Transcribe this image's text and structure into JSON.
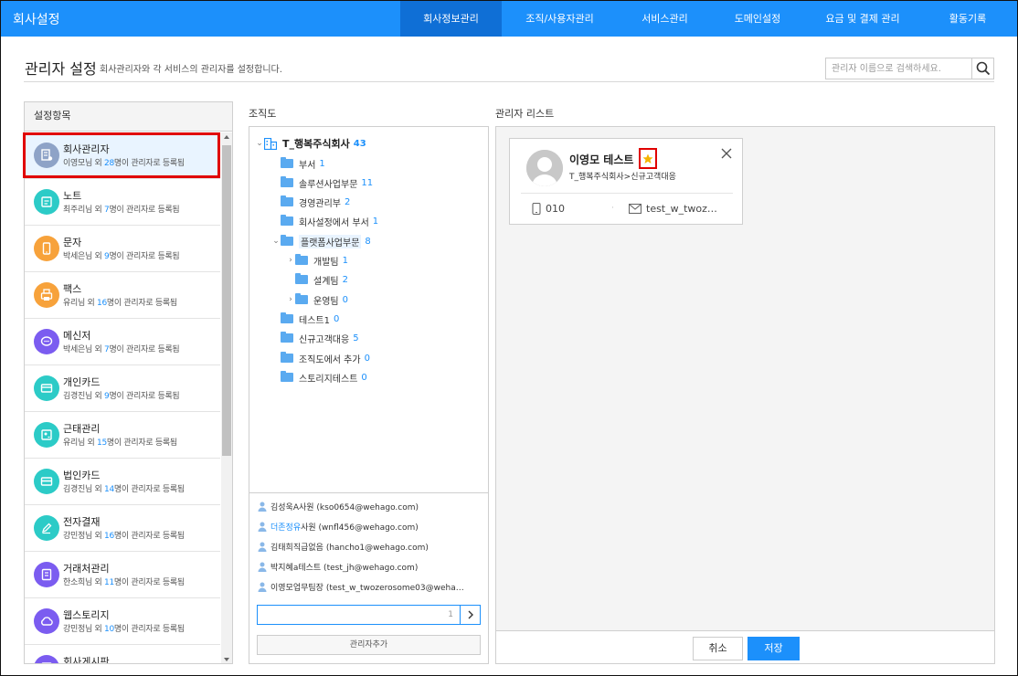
{
  "app_title": "회사설정",
  "top_nav": [
    {
      "label": "회사정보관리",
      "active": true
    },
    {
      "label": "조직/사용자관리",
      "active": false
    },
    {
      "label": "서비스관리",
      "active": false
    },
    {
      "label": "도메인설정",
      "active": false
    },
    {
      "label": "요금 및 결제 관리",
      "active": false
    },
    {
      "label": "활동기록",
      "active": false
    }
  ],
  "header": {
    "title": "관리자 설정",
    "description": "회사관리자와 각 서비스의 관리자를 설정합니다.",
    "search_placeholder": "관리자 이름으로 검색하세요."
  },
  "settings_panel": {
    "title": "설정항목",
    "items": [
      {
        "name": "회사관리자",
        "person": "이영모님 외 ",
        "count": "28",
        "suffix": "명이 관리자로 등록됨",
        "icon": "company-admin-icon",
        "color": "#8ea3c7",
        "selected": true
      },
      {
        "name": "노트",
        "person": "최주리님 외 ",
        "count": "7",
        "suffix": "명이 관리자로 등록됨",
        "icon": "note-icon",
        "color": "#2ccbc7",
        "selected": false
      },
      {
        "name": "문자",
        "person": "박세은님 외 ",
        "count": "9",
        "suffix": "명이 관리자로 등록됨",
        "icon": "sms-icon",
        "color": "#f7a23b",
        "selected": false
      },
      {
        "name": "팩스",
        "person": "유리님 외 ",
        "count": "16",
        "suffix": "명이 관리자로 등록됨",
        "icon": "fax-icon",
        "color": "#f7a23b",
        "selected": false
      },
      {
        "name": "메신저",
        "person": "박세은님 외 ",
        "count": "7",
        "suffix": "명이 관리자로 등록됨",
        "icon": "messenger-icon",
        "color": "#7b5cf0",
        "selected": false
      },
      {
        "name": "개인카드",
        "person": "김경진님 외 ",
        "count": "9",
        "suffix": "명이 관리자로 등록됨",
        "icon": "personal-card-icon",
        "color": "#2ccbc7",
        "selected": false
      },
      {
        "name": "근태관리",
        "person": "유리님 외 ",
        "count": "15",
        "suffix": "명이 관리자로 등록됨",
        "icon": "attendance-icon",
        "color": "#2ccbc7",
        "selected": false
      },
      {
        "name": "법인카드",
        "person": "김경진님 외 ",
        "count": "14",
        "suffix": "명이 관리자로 등록됨",
        "icon": "corporate-card-icon",
        "color": "#2ccbc7",
        "selected": false
      },
      {
        "name": "전자결재",
        "person": "강민정님 외 ",
        "count": "16",
        "suffix": "명이 관리자로 등록됨",
        "icon": "approval-icon",
        "color": "#2ccbc7",
        "selected": false
      },
      {
        "name": "거래처관리",
        "person": "한소희님 외 ",
        "count": "11",
        "suffix": "명이 관리자로 등록됨",
        "icon": "client-icon",
        "color": "#7b5cf0",
        "selected": false
      },
      {
        "name": "웹스토리지",
        "person": "강민정님 외 ",
        "count": "10",
        "suffix": "명이 관리자로 등록됨",
        "icon": "cloud-icon",
        "color": "#7b5cf0",
        "selected": false
      },
      {
        "name": "회사게시판",
        "person": "",
        "count": "",
        "suffix": "",
        "icon": "board-icon",
        "color": "#7b5cf0",
        "selected": false
      }
    ]
  },
  "org_panel": {
    "title": "조직도",
    "root": {
      "name": "T_행복주식회사",
      "count": "43"
    },
    "nodes": [
      {
        "label": "부서",
        "count": "1",
        "level": 1,
        "caret": ""
      },
      {
        "label": "솔루션사업부문",
        "count": "11",
        "level": 1,
        "caret": ""
      },
      {
        "label": "경영관리부",
        "count": "2",
        "level": 1,
        "caret": ""
      },
      {
        "label": "회사설정에서 부서",
        "count": "1",
        "level": 1,
        "caret": ""
      },
      {
        "label": "플랫폼사업부문",
        "count": "8",
        "level": 1,
        "caret": "⌄",
        "highlight": true
      },
      {
        "label": "개발팀",
        "count": "1",
        "level": 2,
        "caret": "›"
      },
      {
        "label": "설계팀",
        "count": "2",
        "level": 2,
        "caret": ""
      },
      {
        "label": "운영팀",
        "count": "0",
        "level": 2,
        "caret": "›"
      },
      {
        "label": "테스트1",
        "count": "0",
        "level": 1,
        "caret": ""
      },
      {
        "label": "신규고객대응",
        "count": "5",
        "level": 1,
        "caret": ""
      },
      {
        "label": "조직도에서 추가",
        "count": "0",
        "level": 1,
        "caret": ""
      },
      {
        "label": "스토리지테스트",
        "count": "0",
        "level": 1,
        "caret": ""
      }
    ],
    "members": [
      {
        "name": "김성욱A",
        "rest": " 사원 (kso0654@wehago.com)",
        "blue": false
      },
      {
        "name": "더존정유",
        "rest": " 사원 (wnfl456@wehago.com)",
        "blue": true
      },
      {
        "name": "김태희",
        "rest": " 직급없음 (hancho1@wehago.com)",
        "blue": false
      },
      {
        "name": "박지혜a",
        "rest": " 테스트 (test_jh@wehago.com)",
        "blue": false
      },
      {
        "name": "이영모",
        "rest": " 업무팀장 (test_w_twozerosome03@weha…",
        "blue": false
      }
    ],
    "member_input_value": "1",
    "add_button": "관리자추가"
  },
  "admin_list": {
    "title": "관리자 리스트",
    "card": {
      "name": "이영모 테스트",
      "org": "T_행복주식회사>신규고객대응",
      "phone": "010",
      "email": "test_w_twoz…"
    },
    "cancel_label": "취소",
    "save_label": "저장"
  },
  "colors": {
    "brand": "#1c90fb",
    "highlight_box": "#e00000",
    "star": "#f5b400"
  }
}
